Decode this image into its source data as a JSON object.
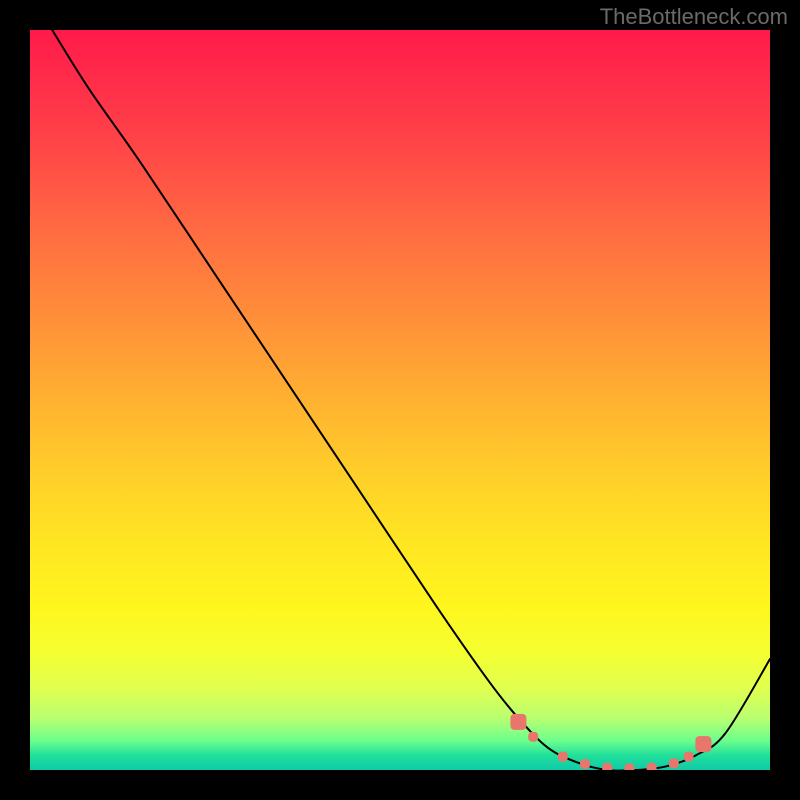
{
  "watermark": "TheBottleneck.com",
  "chart_data": {
    "type": "line",
    "title": "",
    "xlabel": "",
    "ylabel": "",
    "xlim": [
      0,
      100
    ],
    "ylim": [
      0,
      100
    ],
    "grid": false,
    "legend": false,
    "series": [
      {
        "name": "bottleneck-curve",
        "x": [
          3,
          8,
          15,
          25,
          35,
          45,
          55,
          62,
          66,
          70,
          74,
          78,
          82,
          86,
          90,
          94,
          100
        ],
        "y": [
          100,
          92,
          82,
          67,
          52,
          37,
          22,
          12,
          7,
          3,
          1,
          0,
          0,
          0.5,
          2,
          5,
          15
        ]
      }
    ],
    "markers": [
      {
        "x": 66,
        "y": 6.5
      },
      {
        "x": 68,
        "y": 4.5
      },
      {
        "x": 72,
        "y": 1.8
      },
      {
        "x": 75,
        "y": 0.8
      },
      {
        "x": 78,
        "y": 0.3
      },
      {
        "x": 81,
        "y": 0.2
      },
      {
        "x": 84,
        "y": 0.3
      },
      {
        "x": 87,
        "y": 0.9
      },
      {
        "x": 89,
        "y": 1.8
      },
      {
        "x": 91,
        "y": 3.5
      }
    ],
    "gradient_stops": [
      {
        "pct": 0,
        "color": "#ff1a4a"
      },
      {
        "pct": 50,
        "color": "#ffbd2e"
      },
      {
        "pct": 80,
        "color": "#fff61e"
      },
      {
        "pct": 100,
        "color": "#10caa8"
      }
    ]
  }
}
